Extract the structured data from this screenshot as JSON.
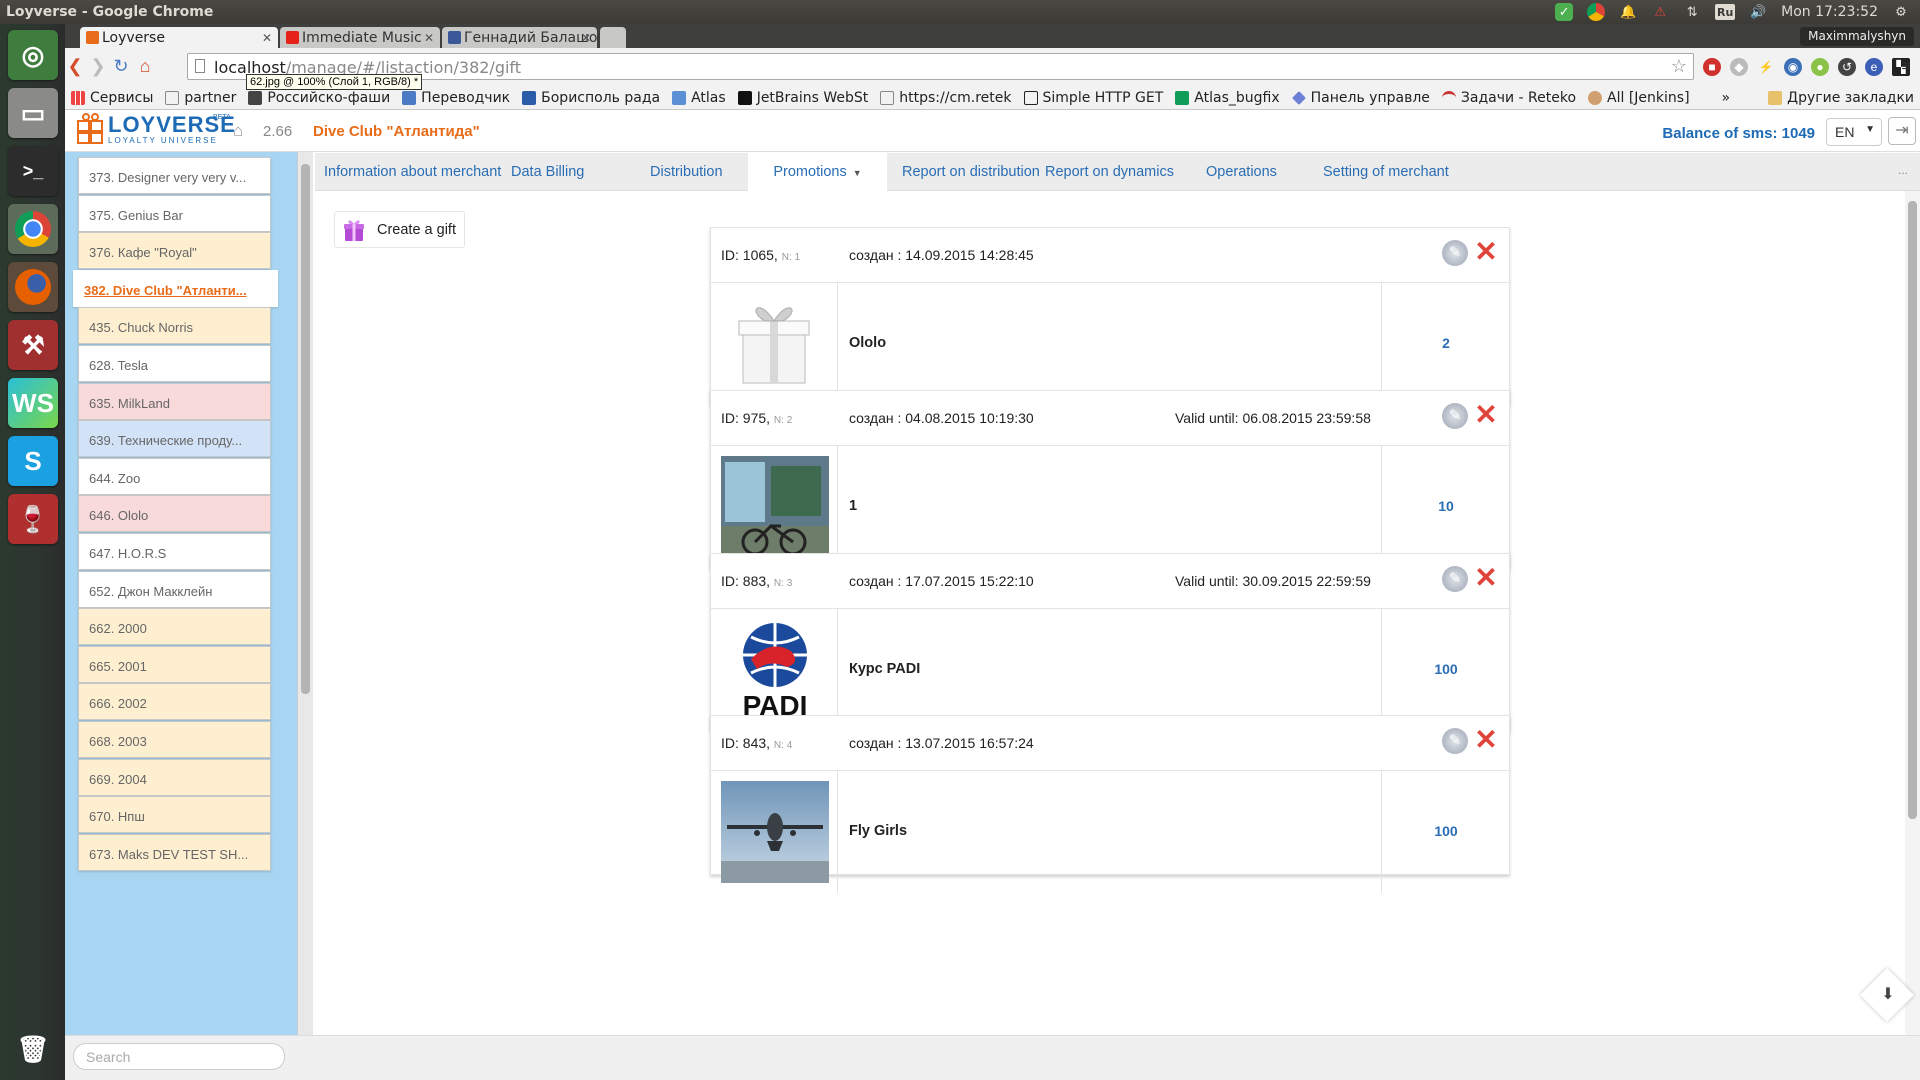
{
  "os": {
    "window_title": "Loyverse - Google Chrome",
    "clock": "Mon 17:23:52",
    "keyboard_layout": "Ru"
  },
  "browser": {
    "tabs": [
      {
        "label": "Loyverse",
        "active": true
      },
      {
        "label": "Immediate Music",
        "active": false
      },
      {
        "label": "Геннадий Балашов",
        "active": false
      }
    ],
    "user": "Maximmalyshyn",
    "url_host": "localhost",
    "url_path": "/manage/#/listaction/382/gift",
    "tooltip": "62.jpg @ 100% (Слой 1, RGB/8) *",
    "bookmarks": [
      "Сервисы",
      "partner",
      "Российско-фаши",
      "Переводчик",
      "Борисполь рада",
      "Atlas",
      "JetBrains WebSt",
      "https://cm.retek",
      "Simple HTTP GET",
      "Atlas_bugfix",
      "Панель управле",
      "Задачи - Reteko",
      "All [Jenkins]"
    ],
    "bookmarks_overflow": "»",
    "other_bookmarks": "Другие закладки"
  },
  "header": {
    "logo_name": "LOYVERSE",
    "logo_sub": "LOYALTY UNIVERSE",
    "logo_beta": "BETA",
    "version": "2.66",
    "merchant": "Dive Club \"Атлантида\"",
    "balance": "Balance of sms: 1049",
    "language": "EN"
  },
  "sidebar": {
    "items": [
      {
        "label": "373. Designer very very v...",
        "color": "white"
      },
      {
        "label": "375. Genius Bar",
        "color": "white"
      },
      {
        "label": "376. Кафе \"Royal\"",
        "color": "yellow"
      },
      {
        "label": "382. Dive Club \"Атланти...",
        "color": "active"
      },
      {
        "label": "435. Chuck Norris",
        "color": "yellow"
      },
      {
        "label": "628. Tesla",
        "color": "white"
      },
      {
        "label": "635. MilkLand",
        "color": "pink"
      },
      {
        "label": "639. Технические проду...",
        "color": "blue"
      },
      {
        "label": "644. Zoo",
        "color": "white"
      },
      {
        "label": "646. Ololo",
        "color": "pink"
      },
      {
        "label": "647. H.O.R.S",
        "color": "white"
      },
      {
        "label": "652. Джон Макклейн",
        "color": "white"
      },
      {
        "label": "662. 2000",
        "color": "yellow"
      },
      {
        "label": "665. 2001",
        "color": "yellow"
      },
      {
        "label": "666. 2002",
        "color": "yellow"
      },
      {
        "label": "668. 2003",
        "color": "yellow"
      },
      {
        "label": "669. 2004",
        "color": "yellow"
      },
      {
        "label": "670. Нпш",
        "color": "yellow"
      },
      {
        "label": "673. Maks DEV TEST SH...",
        "color": "yellow"
      }
    ],
    "search_placeholder": "Search"
  },
  "main_tabs": [
    {
      "label": "Information about merchant"
    },
    {
      "label": "Data Billing"
    },
    {
      "label": "Distribution"
    },
    {
      "label": "Promotions",
      "active": true
    },
    {
      "label": "Report on distribution"
    },
    {
      "label": "Report on dynamics"
    },
    {
      "label": "Operations"
    },
    {
      "label": "Setting of merchant"
    }
  ],
  "more_dots": "...",
  "create_gift_label": "Create a gift",
  "gifts": [
    {
      "id": "ID: 1065,",
      "n": "N: 1",
      "created": "создан : 14.09.2015 14:28:45",
      "valid": "",
      "name": "Ololo",
      "points": "2",
      "image": "gift-box"
    },
    {
      "id": "ID: 975,",
      "n": "N: 2",
      "created": "создан : 04.08.2015 10:19:30",
      "valid": "Valid until: 06.08.2015 23:59:58",
      "name": "1",
      "points": "10",
      "image": "shop-photo"
    },
    {
      "id": "ID: 883,",
      "n": "N: 3",
      "created": "создан : 17.07.2015 15:22:10",
      "valid": "Valid until: 30.09.2015 22:59:59",
      "name": "Курс PADI",
      "points": "100",
      "image": "padi-logo"
    },
    {
      "id": "ID: 843,",
      "n": "N: 4",
      "created": "создан : 13.07.2015 16:57:24",
      "valid": "",
      "name": "Fly Girls",
      "points": "100",
      "image": "airplane-photo"
    }
  ],
  "padi_text": "PADI",
  "colors": {
    "accent_orange": "#e86c1a",
    "link_blue": "#2a6db4",
    "sidebar_bg": "#a8d5f1",
    "delete_red": "#e0433a"
  }
}
